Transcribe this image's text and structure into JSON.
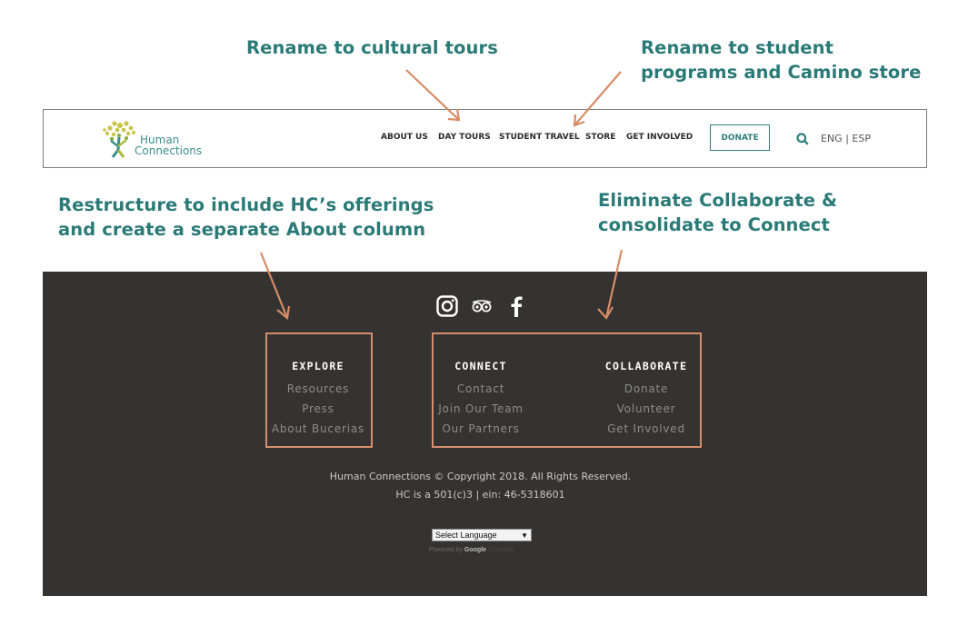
{
  "annotations": {
    "cultural_tours": "Rename to cultural tours",
    "student_line1": "Rename to student",
    "student_line2": "programs and Camino store",
    "restructure_line1": "Restructure to include HC’s offerings",
    "restructure_line2": "and create a separate About column",
    "eliminate_line1": "Eliminate Collaborate &",
    "eliminate_line2": "consolidate to Connect"
  },
  "header": {
    "logo_line1": "Human",
    "logo_line2": "Connections",
    "nav": [
      "ABOUT US",
      "DAY TOURS",
      "STUDENT TRAVEL",
      "STORE",
      "GET INVOLVED"
    ],
    "donate_label": "DONATE",
    "lang": "ENG | ESP"
  },
  "footer": {
    "social_icons": [
      "instagram-icon",
      "tripadvisor-icon",
      "facebook-icon"
    ],
    "columns": [
      {
        "heading": "EXPLORE",
        "links": [
          "Resources",
          "Press",
          "About Bucerias"
        ]
      },
      {
        "heading": "CONNECT",
        "links": [
          "Contact",
          "Join Our Team",
          "Our Partners"
        ]
      },
      {
        "heading": "COLLABORATE",
        "links": [
          "Donate",
          "Volunteer",
          "Get Involved"
        ]
      }
    ],
    "copyright": "Human Connections © Copyright 2018. All Rights Reserved.",
    "ein": "HC is a 501(c)3 | ein: 46-5318601",
    "language_select": "Select Language",
    "powered_by": "Powered by",
    "google": "Google",
    "translate": "Translate"
  },
  "colors": {
    "annotation_text": "#2a7a77",
    "annotation_arrow": "#d68c66",
    "footer_bg": "#343332",
    "brand_teal": "#2f7e7c"
  }
}
